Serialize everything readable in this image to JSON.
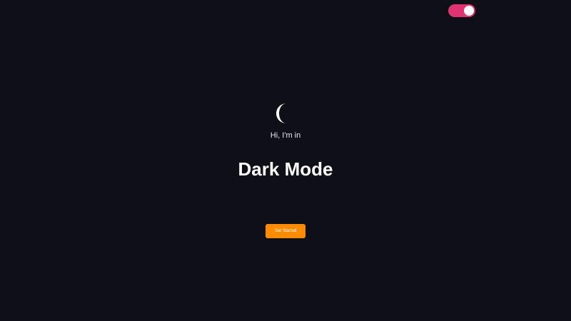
{
  "theme_toggle": {
    "state": "on",
    "color": "#e0336f"
  },
  "hero": {
    "icon": "moon-icon",
    "greeting": "Hi, I'm in",
    "title": "Dark Mode",
    "cta_label": "Get Started",
    "cta_color": "#ff8c00"
  },
  "colors": {
    "background": "#0f0f17",
    "text": "#ffffff"
  }
}
